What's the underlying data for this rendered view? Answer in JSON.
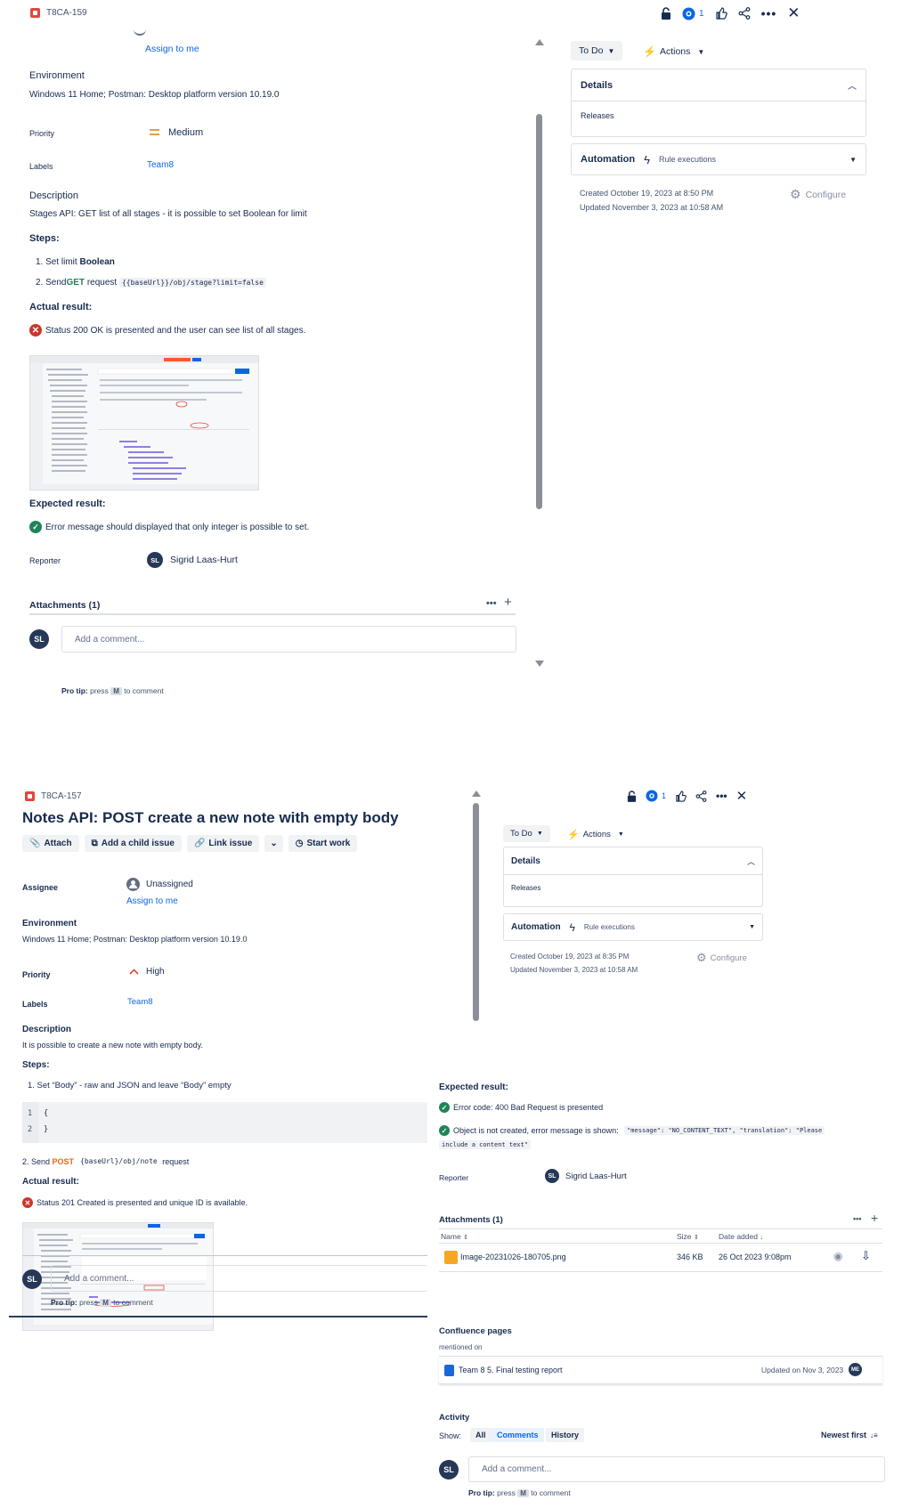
{
  "screen1": {
    "issue_key": "T8CA-159",
    "watch_count": "1",
    "assign_to_me": "Assign to me",
    "environment_title": "Environment",
    "environment_value": "Windows 11 Home; Postman: Desktop platform version 10.19.0",
    "priority_label": "Priority",
    "priority_value": "Medium",
    "labels_label": "Labels",
    "labels_value": "Team8",
    "description_title": "Description",
    "description_text": "Stages API: GET list of all stages - it is possible to set Boolean for limit",
    "steps_title": "Steps:",
    "step1_prefix": "1. Set limit ",
    "step1_bold": "Boolean",
    "step2_prefix": "2. Send ",
    "step2_method": "GET",
    "step2_mid": " request ",
    "step2_code": "{{baseUrl}}/obj/stage?limit=false",
    "actual_title": "Actual result:",
    "actual_text": "Status 200 OK is presented and the user can see list of all stages.",
    "expected_title": "Expected result:",
    "expected_text": "Error message should displayed that only integer is possible to set.",
    "reporter_label": "Reporter",
    "reporter_name": "Sigrid Laas-Hurt",
    "reporter_initials": "SL",
    "attachments_title": "Attachments (1)",
    "comment_initials": "SL",
    "comment_placeholder": "Add a comment...",
    "protip_bold": "Pro tip:",
    "protip_press": " press ",
    "protip_key": "M",
    "protip_rest": " to comment",
    "status_button": "To Do",
    "actions_button": "Actions",
    "details_title": "Details",
    "releases_label": "Releases",
    "automation_title": "Automation",
    "rule_executions": "Rule executions",
    "created": "Created October 19, 2023 at 8:50 PM",
    "updated": "Updated November 3, 2023 at 10:58 AM",
    "configure": "Configure"
  },
  "screen2": {
    "issue_key": "T8CA-157",
    "watch_count": "1",
    "title": "Notes API: POST create a new note with empty body",
    "toolbar": {
      "attach": "Attach",
      "add_child": "Add a child issue",
      "link_issue": "Link issue",
      "start_work": "Start work"
    },
    "assignee_label": "Assignee",
    "assignee_value": "Unassigned",
    "assign_to_me": "Assign to me",
    "environment_title": "Environment",
    "environment_value": "Windows 11 Home; Postman: Desktop platform version 10.19.0",
    "priority_label": "Priority",
    "priority_value": "High",
    "labels_label": "Labels",
    "labels_value": "Team8",
    "description_title": "Description",
    "description_text": "It is possible to create a new note with empty body.",
    "steps_title": "Steps:",
    "step1": "1. Set “Body” - raw and JSON and leave “Body” empty",
    "code_line1_no": "1",
    "code_line1": "{",
    "code_line2_no": "2",
    "code_line2": "}",
    "step2_prefix": "2. Send ",
    "step2_method": "POST",
    "step2_code": "{baseUrl}/obj/note",
    "step2_suffix": " request",
    "actual_title": "Actual result:",
    "actual_text": "Status 201 Created is presented and unique ID is available.",
    "comment_initials": "SL",
    "comment_placeholder": "Add a comment...",
    "protip_bold": "Pro tip:",
    "protip_press": " press ",
    "protip_key": "M",
    "protip_rest": " to comment",
    "status_button": "To Do",
    "actions_button": "Actions",
    "details_title": "Details",
    "releases_label": "Releases",
    "automation_title": "Automation",
    "rule_executions": "Rule executions",
    "created": "Created October 19, 2023 at 8:35 PM",
    "updated": "Updated November 3, 2023 at 10:58 AM",
    "configure": "Configure",
    "expected_title": "Expected result:",
    "expected_1": "Error code: 400 Bad Request is presented",
    "expected_2_prefix": "Object is not created, error message is shown: ",
    "expected_2_code": "\"message\": \"NO_CONTENT_TEXT\", \"translation\": \"Please",
    "expected_2_code_cont": "include a content text\"",
    "reporter_label": "Reporter",
    "reporter_name": "Sigrid Laas-Hurt",
    "reporter_initials": "SL",
    "attachments_title": "Attachments (1)",
    "attach_table": {
      "col_name": "Name",
      "col_size": "Size",
      "col_date": "Date added",
      "file_name": "Image-20231026-180705.png",
      "file_size": "346 KB",
      "file_date": "26 Oct 2023 9:08pm"
    },
    "confluence_title": "Confluence pages",
    "mentioned_on": "mentioned on",
    "confluence_page": "Team 8 5. Final testing report",
    "confluence_updated": "Updated on Nov 3, 2023",
    "confluence_avatar": "ME",
    "activity_title": "Activity",
    "show_label": "Show:",
    "filter_all": "All",
    "filter_comments": "Comments",
    "filter_history": "History",
    "sort_label": "Newest first",
    "activity_comment_placeholder": "Add a comment..."
  }
}
